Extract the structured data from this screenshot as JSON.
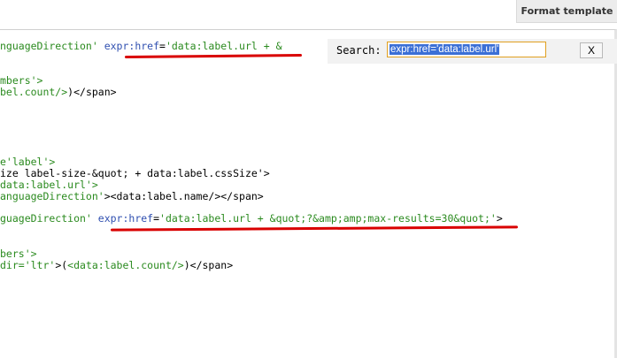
{
  "toolbar": {
    "format_label": "Format template"
  },
  "search": {
    "label": "Search:",
    "query": "expr:href='data:label.url'",
    "close_label": "X"
  },
  "code_lines": [
    {
      "parts": [
        {
          "text": "nguageDirection' ",
          "kind": "str"
        },
        {
          "text": "expr:href",
          "kind": "attr"
        },
        {
          "text": "=",
          "kind": "text"
        },
        {
          "text": "'data:label.url + &",
          "kind": "str"
        }
      ]
    },
    {
      "parts": [
        {
          "text": "mbers'>",
          "kind": "str"
        }
      ]
    },
    {
      "parts": [
        {
          "text": "bel.count/>",
          "kind": "str"
        },
        {
          "text": ")</span>",
          "kind": "text"
        }
      ]
    },
    {
      "parts": [
        {
          "text": "e'label'>",
          "kind": "str"
        }
      ]
    },
    {
      "parts": [
        {
          "text": "ize label-size-&quot; + data:label.cssSize'>",
          "kind": "text"
        }
      ]
    },
    {
      "parts": [
        {
          "text": "data:label.url'>",
          "kind": "str"
        }
      ]
    },
    {
      "parts": [
        {
          "text": "anguageDirection'",
          "kind": "str"
        },
        {
          "text": "><data:label.name/></span>",
          "kind": "text"
        }
      ]
    },
    {
      "parts": [
        {
          "text": "guageDirection' ",
          "kind": "str"
        },
        {
          "text": "expr:href",
          "kind": "attr"
        },
        {
          "text": "=",
          "kind": "text"
        },
        {
          "text": "'data:label.url + &quot;?&amp;amp;max-results=30&quot;'",
          "kind": "str"
        },
        {
          "text": ">",
          "kind": "text"
        }
      ]
    },
    {
      "parts": [
        {
          "text": "bers'>",
          "kind": "str"
        }
      ]
    },
    {
      "parts": [
        {
          "text": "dir='ltr'",
          "kind": "str"
        },
        {
          "text": ">(",
          "kind": "text"
        },
        {
          "text": "<data:label.count/>",
          "kind": "str"
        },
        {
          "text": ")</span>",
          "kind": "text"
        }
      ]
    }
  ],
  "colors": {
    "string": "#2a8a1e",
    "attribute": "#2f4fb0",
    "text": "#000000",
    "annotation": "#d90000",
    "selection": "#3b6fd6"
  }
}
